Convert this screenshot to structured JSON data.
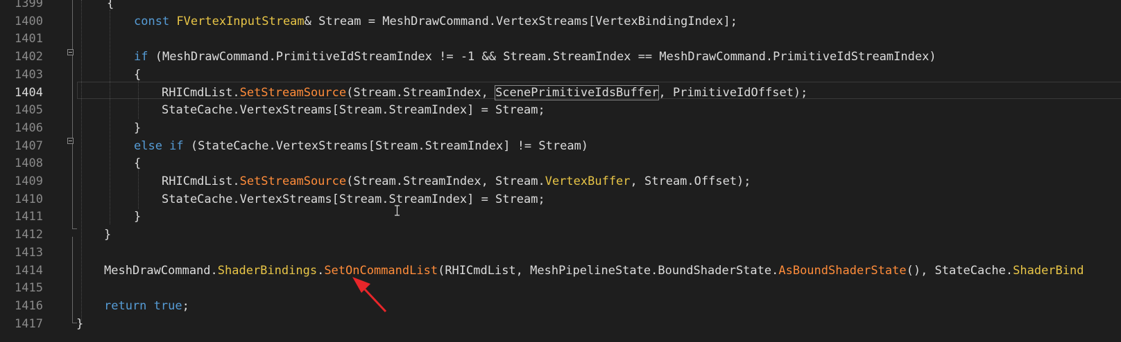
{
  "editor": {
    "line_numbers": [
      "1399",
      "1400",
      "1401",
      "1402",
      "1403",
      "1404",
      "1405",
      "1406",
      "1407",
      "1408",
      "1409",
      "1410",
      "1411",
      "1412",
      "1413",
      "1414",
      "1415",
      "1416",
      "1417"
    ],
    "current_line": "1404",
    "lines": [
      [
        {
          "t": "{",
          "c": "plain"
        }
      ],
      [
        {
          "t": "const ",
          "c": "kw"
        },
        {
          "t": "FVertexInputStream",
          "c": "type"
        },
        {
          "t": "& Stream = MeshDrawCommand.VertexStreams[VertexBindingIndex];",
          "c": "plain"
        }
      ],
      [],
      [
        {
          "t": "if",
          "c": "kw"
        },
        {
          "t": " (MeshDrawCommand.PrimitiveIdStreamIndex != -1 && Stream.StreamIndex == MeshDrawCommand.PrimitiveIdStreamIndex)",
          "c": "plain"
        }
      ],
      [
        {
          "t": "{",
          "c": "plain"
        }
      ],
      [
        {
          "t": "RHICmdList.",
          "c": "plain"
        },
        {
          "t": "SetStreamSource",
          "c": "method"
        },
        {
          "t": "(Stream.StreamIndex, ",
          "c": "plain"
        },
        {
          "t": "ScenePrimitiveIdsBuffer",
          "c": "boxed"
        },
        {
          "t": ", PrimitiveIdOffset);",
          "c": "plain"
        }
      ],
      [
        {
          "t": "StateCache.VertexStreams[Stream.StreamIndex] = Stream;",
          "c": "plain"
        }
      ],
      [
        {
          "t": "}",
          "c": "plain"
        }
      ],
      [
        {
          "t": "else if",
          "c": "kw"
        },
        {
          "t": " (StateCache.VertexStreams[Stream.StreamIndex] != Stream)",
          "c": "plain"
        }
      ],
      [
        {
          "t": "{",
          "c": "plain"
        }
      ],
      [
        {
          "t": "RHICmdList.",
          "c": "plain"
        },
        {
          "t": "SetStreamSource",
          "c": "method"
        },
        {
          "t": "(Stream.StreamIndex, Stream.",
          "c": "plain"
        },
        {
          "t": "VertexBuffer",
          "c": "member"
        },
        {
          "t": ", Stream.Offset);",
          "c": "plain"
        }
      ],
      [
        {
          "t": "StateCache.VertexStreams[Stream.StreamIndex] = Stream;",
          "c": "plain"
        }
      ],
      [
        {
          "t": "}",
          "c": "plain"
        }
      ],
      [
        {
          "t": "}",
          "c": "plain"
        }
      ],
      [],
      [
        {
          "t": "MeshDrawCommand.",
          "c": "plain"
        },
        {
          "t": "ShaderBindings",
          "c": "member"
        },
        {
          "t": ".",
          "c": "plain"
        },
        {
          "t": "SetOnCommandList",
          "c": "method"
        },
        {
          "t": "(RHICmdList, MeshPipelineState.BoundShaderState.",
          "c": "plain"
        },
        {
          "t": "AsBoundShaderState",
          "c": "method"
        },
        {
          "t": "(), StateCache.",
          "c": "plain"
        },
        {
          "t": "ShaderBind",
          "c": "member"
        }
      ],
      [],
      [
        {
          "t": "return ",
          "c": "kw"
        },
        {
          "t": "true",
          "c": "kw"
        },
        {
          "t": ";",
          "c": "plain"
        }
      ],
      [
        {
          "t": "}",
          "c": "plain"
        }
      ]
    ]
  },
  "colors": {
    "background": "#1e1e1e",
    "keyword": "#569cd6",
    "type": "#e8c547",
    "method": "#ff8c3a",
    "plain": "#dcdcdc",
    "line_number": "#8a8a8a",
    "annotation_arrow": "#e8262a"
  },
  "annotation": {
    "icon": "red-arrow-icon"
  }
}
